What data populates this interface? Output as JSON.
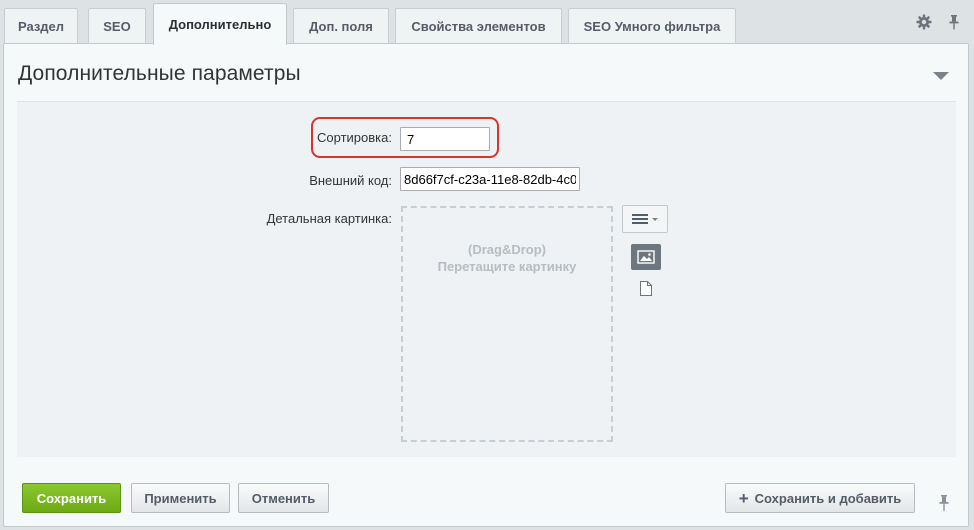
{
  "tabs": [
    {
      "label": "Раздел",
      "active": false
    },
    {
      "label": "SEO",
      "active": false
    },
    {
      "label": "Дополнительно",
      "active": true
    },
    {
      "label": "Доп. поля",
      "active": false
    },
    {
      "label": "Свойства элементов",
      "active": false
    },
    {
      "label": "SEO Умного фильтра",
      "active": false
    }
  ],
  "icons": {
    "settings": "gear-icon",
    "pin": "pin-icon"
  },
  "section": {
    "title": "Дополнительные параметры"
  },
  "fields": {
    "sort": {
      "label": "Сортировка:",
      "value": "7"
    },
    "external_code": {
      "label": "Внешний код:",
      "value": "8d66f7cf-c23a-11e8-82db-4c0"
    },
    "detail_picture": {
      "label": "Детальная картинка:",
      "dropzone_line1": "(Drag&Drop)",
      "dropzone_line2": "Перетащите картинку"
    }
  },
  "buttons": {
    "save": "Сохранить",
    "apply": "Применить",
    "cancel": "Отменить",
    "save_and_add": "Сохранить и добавить"
  },
  "colors": {
    "highlight": "#d9342b",
    "save_button": "#77b51c"
  }
}
